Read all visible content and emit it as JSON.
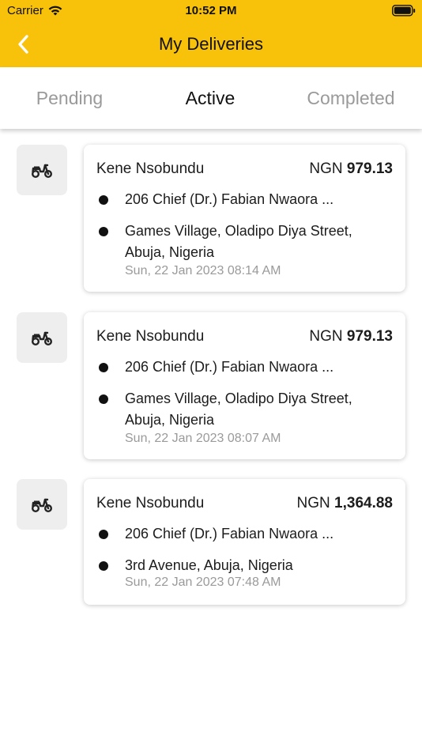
{
  "status_bar": {
    "carrier": "Carrier",
    "time": "10:52 PM"
  },
  "header": {
    "title": "My Deliveries",
    "back_icon": "chevron-left-icon",
    "color": "#F8C10A"
  },
  "tabs": [
    {
      "label": "Pending",
      "active": false
    },
    {
      "label": "Active",
      "active": true
    },
    {
      "label": "Completed",
      "active": false
    }
  ],
  "deliveries": [
    {
      "icon": "scooter-icon",
      "name": "Kene Nsobundu",
      "currency": "NGN",
      "amount": "979.13",
      "pickup": "206 Chief (Dr.) Fabian Nwaora ...",
      "dropoff": "Games Village, Oladipo Diya Street, Abuja, Nigeria",
      "date": "Sun, 22 Jan 2023 08:14 AM"
    },
    {
      "icon": "scooter-icon",
      "name": "Kene Nsobundu",
      "currency": "NGN",
      "amount": "979.13",
      "pickup": "206 Chief (Dr.) Fabian Nwaora ...",
      "dropoff": "Games Village, Oladipo Diya Street, Abuja, Nigeria",
      "date": "Sun, 22 Jan 2023 08:07 AM"
    },
    {
      "icon": "scooter-icon",
      "name": "Kene Nsobundu",
      "currency": "NGN",
      "amount": "1,364.88",
      "pickup": "206 Chief (Dr.) Fabian Nwaora ...",
      "dropoff": "3rd Avenue, Abuja, Nigeria",
      "date": "Sun, 22 Jan 2023 07:48 AM"
    }
  ]
}
